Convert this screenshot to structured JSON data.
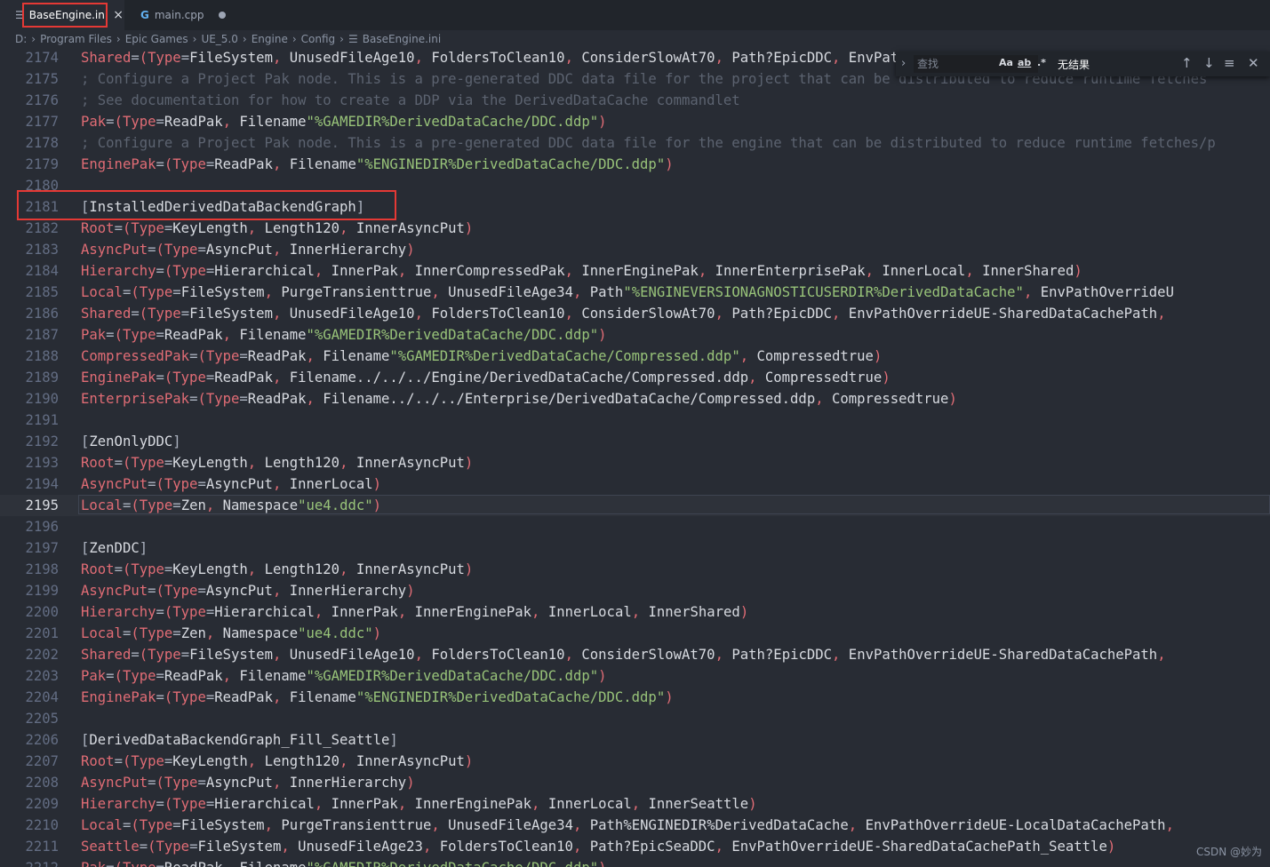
{
  "tabs": [
    {
      "label": "BaseEngine.ini",
      "icon": "menu-lines-icon",
      "close": "×",
      "active": true
    },
    {
      "label": "main.cpp",
      "icon": "cpp-file-icon",
      "modified": true
    }
  ],
  "breadcrumb": [
    "D:",
    "Program Files",
    "Epic Games",
    "UE_5.0",
    "Engine",
    "Config",
    "BaseEngine.ini"
  ],
  "find_widget": {
    "placeholder": "查找",
    "match_case": "Aa",
    "whole_word": "ab",
    "regex": ".*",
    "result": "无结果"
  },
  "editor": {
    "active_line": "2195",
    "lines": [
      {
        "n": "2174",
        "t": "Shared=(Type=FileSystem, UnusedFileAge=10, FoldersToClean=10, ConsiderSlowAt=70, Path=?EpicDDC, EnvPathOverride=UE-SharedDataCachePath,"
      },
      {
        "n": "2175",
        "t": "; Configure a Project Pak node. This is a pre-generated DDC data file for the project that can be distributed to reduce runtime fetches"
      },
      {
        "n": "2176",
        "t": "; See documentation for how to create a DDP via the DerivedDataCache commandlet"
      },
      {
        "n": "2177",
        "t": "Pak=(Type=ReadPak, Filename=\"%GAMEDIR%DerivedDataCache/DDC.ddp\")"
      },
      {
        "n": "2178",
        "t": "; Configure a Project Pak node. This is a pre-generated DDC data file for the engine that can be distributed to reduce runtime fetches/p"
      },
      {
        "n": "2179",
        "t": "EnginePak=(Type=ReadPak, Filename=\"%ENGINEDIR%DerivedDataCache/DDC.ddp\")"
      },
      {
        "n": "2180",
        "t": ""
      },
      {
        "n": "2181",
        "t": "[InstalledDerivedDataBackendGraph]"
      },
      {
        "n": "2182",
        "t": "Root=(Type=KeyLength, Length=120, Inner=AsyncPut)"
      },
      {
        "n": "2183",
        "t": "AsyncPut=(Type=AsyncPut, Inner=Hierarchy)"
      },
      {
        "n": "2184",
        "t": "Hierarchy=(Type=Hierarchical, Inner=Pak, Inner=CompressedPak, Inner=EnginePak, Inner=EnterprisePak, Inner=Local, Inner=Shared)"
      },
      {
        "n": "2185",
        "t": "Local=(Type=FileSystem, PurgeTransient=true, UnusedFileAge=34, Path=\"%ENGINEVERSIONAGNOSTICUSERDIR%DerivedDataCache\", EnvPathOverride=U"
      },
      {
        "n": "2186",
        "t": "Shared=(Type=FileSystem, UnusedFileAge=10, FoldersToClean=10, ConsiderSlowAt=70, Path=?EpicDDC, EnvPathOverride=UE-SharedDataCachePath,"
      },
      {
        "n": "2187",
        "t": "Pak=(Type=ReadPak, Filename=\"%GAMEDIR%DerivedDataCache/DDC.ddp\")"
      },
      {
        "n": "2188",
        "t": "CompressedPak=(Type=ReadPak, Filename=\"%GAMEDIR%DerivedDataCache/Compressed.ddp\", Compressed=true)"
      },
      {
        "n": "2189",
        "t": "EnginePak=(Type=ReadPak, Filename=../../../Engine/DerivedDataCache/Compressed.ddp, Compressed=true)"
      },
      {
        "n": "2190",
        "t": "EnterprisePak=(Type=ReadPak, Filename=../../../Enterprise/DerivedDataCache/Compressed.ddp, Compressed=true)"
      },
      {
        "n": "2191",
        "t": ""
      },
      {
        "n": "2192",
        "t": "[ZenOnlyDDC]"
      },
      {
        "n": "2193",
        "t": "Root=(Type=KeyLength, Length=120, Inner=AsyncPut)"
      },
      {
        "n": "2194",
        "t": "AsyncPut=(Type=AsyncPut, Inner=Local)"
      },
      {
        "n": "2195",
        "t": "Local=(Type=Zen, Namespace=\"ue4.ddc\")"
      },
      {
        "n": "2196",
        "t": ""
      },
      {
        "n": "2197",
        "t": "[ZenDDC]"
      },
      {
        "n": "2198",
        "t": "Root=(Type=KeyLength, Length=120, Inner=AsyncPut)"
      },
      {
        "n": "2199",
        "t": "AsyncPut=(Type=AsyncPut, Inner=Hierarchy)"
      },
      {
        "n": "2200",
        "t": "Hierarchy=(Type=Hierarchical, Inner=Pak, Inner=EnginePak, Inner=Local, Inner=Shared)"
      },
      {
        "n": "2201",
        "t": "Local=(Type=Zen, Namespace=\"ue4.ddc\")"
      },
      {
        "n": "2202",
        "t": "Shared=(Type=FileSystem, UnusedFileAge=10, FoldersToClean=10, ConsiderSlowAt=70, Path=?EpicDDC, EnvPathOverride=UE-SharedDataCachePath,"
      },
      {
        "n": "2203",
        "t": "Pak=(Type=ReadPak, Filename=\"%GAMEDIR%DerivedDataCache/DDC.ddp\")"
      },
      {
        "n": "2204",
        "t": "EnginePak=(Type=ReadPak, Filename=\"%ENGINEDIR%DerivedDataCache/DDC.ddp\")"
      },
      {
        "n": "2205",
        "t": ""
      },
      {
        "n": "2206",
        "t": "[DerivedDataBackendGraph_Fill_Seattle]"
      },
      {
        "n": "2207",
        "t": "Root=(Type=KeyLength, Length=120, Inner=AsyncPut)"
      },
      {
        "n": "2208",
        "t": "AsyncPut=(Type=AsyncPut, Inner=Hierarchy)"
      },
      {
        "n": "2209",
        "t": "Hierarchy=(Type=Hierarchical, Inner=Pak, Inner=EnginePak, Inner=Local, Inner=Seattle)"
      },
      {
        "n": "2210",
        "t": "Local=(Type=FileSystem, PurgeTransient=true, UnusedFileAge=34, Path=%ENGINEDIR%DerivedDataCache, EnvPathOverride=UE-LocalDataCachePath,"
      },
      {
        "n": "2211",
        "t": "Seattle=(Type=FileSystem, UnusedFileAge=23, FoldersToClean=10, Path=?EpicSeaDDC, EnvPathOverride=UE-SharedDataCachePath_Seattle)"
      },
      {
        "n": "2212",
        "t": "Pak=(Type=ReadPak, Filename=\"%GAMEDIR%DerivedDataCache/DDC.ddp\")"
      }
    ]
  },
  "watermark": "CSDN @妙为"
}
